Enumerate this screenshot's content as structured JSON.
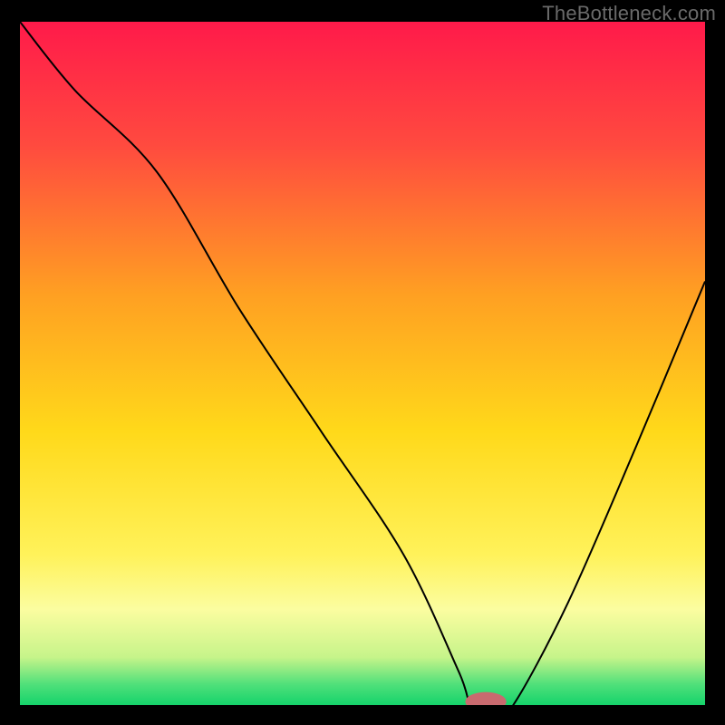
{
  "watermark": "TheBottleneck.com",
  "chart_data": {
    "type": "line",
    "title": "",
    "xlabel": "",
    "ylabel": "",
    "xlim": [
      0,
      100
    ],
    "ylim": [
      0,
      100
    ],
    "grid": false,
    "legend": false,
    "background_gradient_stops": [
      {
        "offset": 0.0,
        "color": "#ff1a4a"
      },
      {
        "offset": 0.18,
        "color": "#ff4a3f"
      },
      {
        "offset": 0.4,
        "color": "#ffa022"
      },
      {
        "offset": 0.6,
        "color": "#ffd91a"
      },
      {
        "offset": 0.78,
        "color": "#fff25a"
      },
      {
        "offset": 0.86,
        "color": "#fbfda0"
      },
      {
        "offset": 0.93,
        "color": "#c6f48a"
      },
      {
        "offset": 0.97,
        "color": "#4fe07a"
      },
      {
        "offset": 1.0,
        "color": "#15d36b"
      }
    ],
    "series": [
      {
        "name": "bottleneck-curve",
        "x": [
          0,
          8,
          20,
          32,
          44,
          56,
          64,
          66,
          70,
          72,
          80,
          90,
          100
        ],
        "y": [
          100,
          90,
          78,
          58,
          40,
          22,
          5,
          0,
          0,
          0,
          15,
          38,
          62
        ]
      }
    ],
    "marker": {
      "name": "optimal-point",
      "x": 68,
      "y": 0.5,
      "color": "#c96a6f",
      "rx": 3.0,
      "ry": 1.4
    }
  }
}
